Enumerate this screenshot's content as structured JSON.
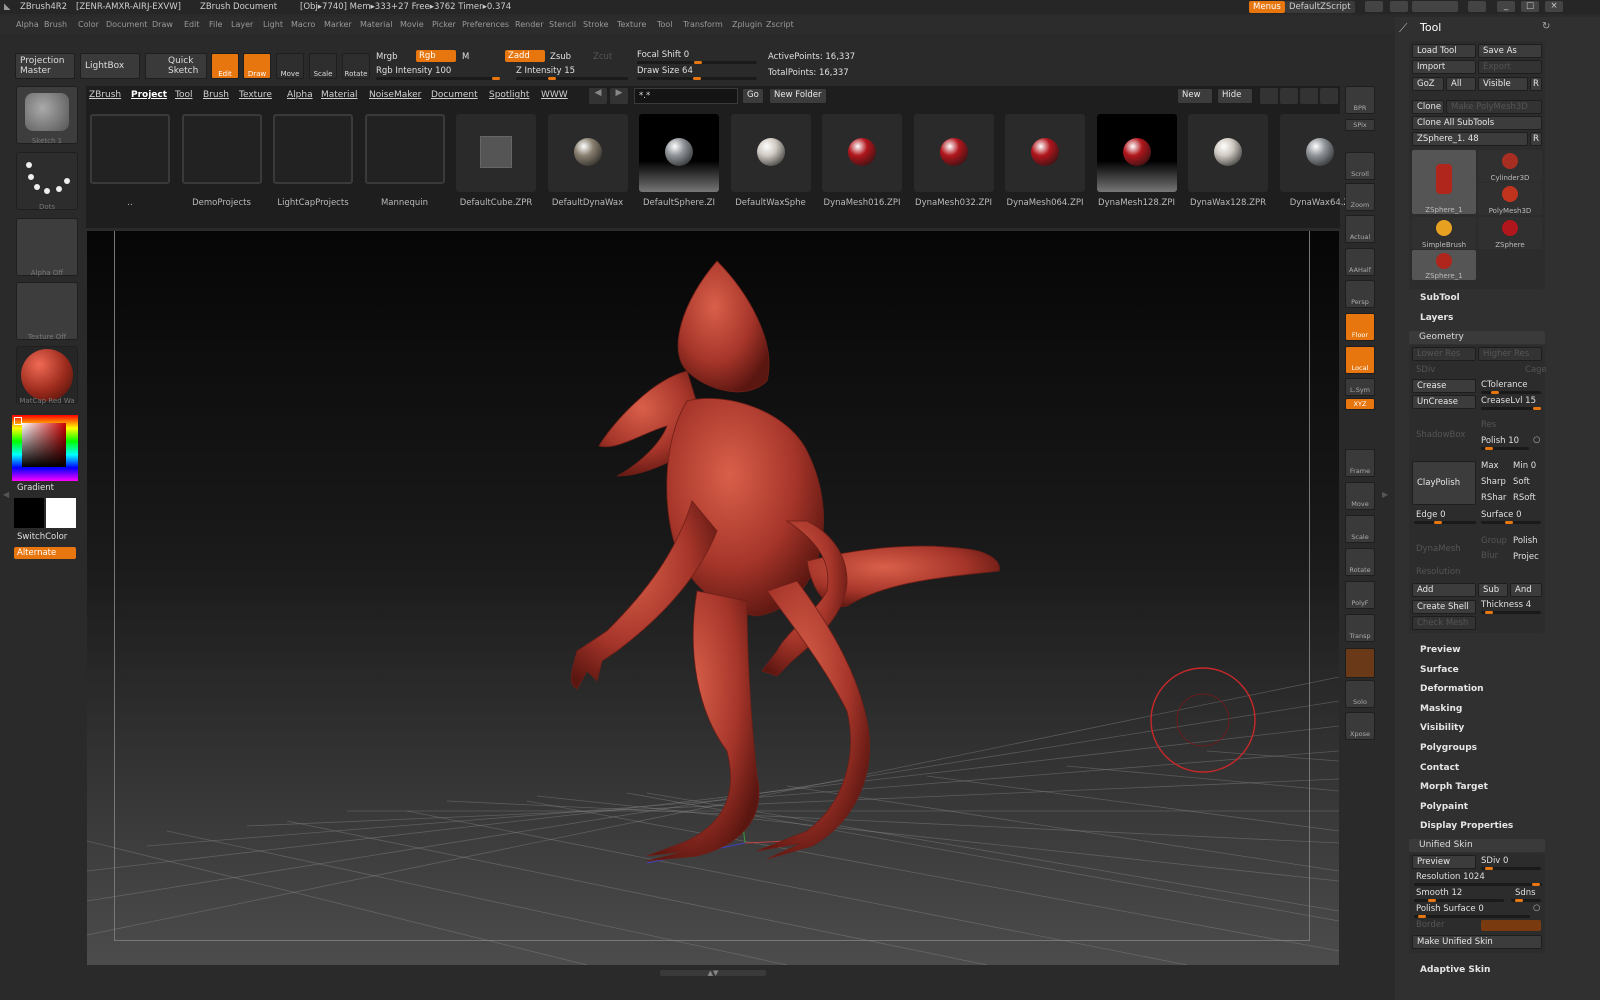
{
  "titlebar": {
    "app": "ZBrush4R2",
    "serial": "[ZENR-AMXR-AIRJ-EXVW]",
    "doc": "ZBrush Document",
    "stats": "[Obj▸7740] Mem▸333+27 Free▸3762 Timer▸0.374",
    "menus_btn": "Menus",
    "script_btn": "DefaultZScript"
  },
  "menubar": [
    "Alpha",
    "Brush",
    "Color",
    "Document",
    "Draw",
    "Edit",
    "File",
    "Layer",
    "Light",
    "Macro",
    "Marker",
    "Material",
    "Movie",
    "Picker",
    "Preferences",
    "Render",
    "Stencil",
    "Stroke",
    "Texture",
    "Tool",
    "Transform",
    "Zplugin",
    "Zscript"
  ],
  "toolbar": {
    "projection_master": "Projection Master",
    "lightbox": "LightBox",
    "quick_sketch": "Quick Sketch",
    "edit": "Edit",
    "draw": "Draw",
    "move": "Move",
    "scale": "Scale",
    "rotate": "Rotate",
    "mrgb": "Mrgb",
    "rgb": "Rgb",
    "m": "M",
    "zadd": "Zadd",
    "zsub": "Zsub",
    "zcut": "Zcut",
    "rgb_intensity": "Rgb Intensity 100",
    "z_intensity": "Z Intensity 15",
    "focal_shift": "Focal Shift 0",
    "draw_size": "Draw Size 64",
    "active_points": "ActivePoints: 16,337",
    "total_points": "TotalPoints: 16,337"
  },
  "leftshelf": {
    "sketch": "Sketch 1",
    "dots": "Dots",
    "alpha": "Alpha Off",
    "texture": "Texture Off",
    "matcap": "MatCap Red Wa",
    "gradient": "Gradient",
    "switchcolor": "SwitchColor",
    "alternate": "Alternate"
  },
  "lightbox": {
    "tabs": [
      "ZBrush",
      "Project",
      "Tool",
      "Brush",
      "Texture",
      "Alpha",
      "Material",
      "NoiseMaker",
      "Document",
      "Spotlight",
      "WWW"
    ],
    "search": "*.*",
    "go": "Go",
    "new_folder": "New Folder",
    "new": "New",
    "hide": "Hide",
    "items": [
      {
        "name": "..",
        "kind": "folder"
      },
      {
        "name": "DemoProjects",
        "kind": "folder"
      },
      {
        "name": "LightCapProjects",
        "kind": "folder"
      },
      {
        "name": "Mannequin",
        "kind": "folder"
      },
      {
        "name": "DefaultCube.ZPR",
        "kind": "cube"
      },
      {
        "name": "DefaultDynaWax",
        "kind": "ball",
        "color": "#8a8070"
      },
      {
        "name": "DefaultSphere.ZI",
        "kind": "ball",
        "color": "#8f9499"
      },
      {
        "name": "DefaultWaxSphe",
        "kind": "ball",
        "color": "#cfcac2"
      },
      {
        "name": "DynaMesh016.ZPI",
        "kind": "ball",
        "color": "#b0161c"
      },
      {
        "name": "DynaMesh032.ZPI",
        "kind": "ball",
        "color": "#b0161c"
      },
      {
        "name": "DynaMesh064.ZPI",
        "kind": "ball",
        "color": "#b0161c"
      },
      {
        "name": "DynaMesh128.ZPI",
        "kind": "ball",
        "color": "#b0161c"
      },
      {
        "name": "DynaWax128.ZPR",
        "kind": "ball",
        "color": "#cfcac2"
      },
      {
        "name": "DynaWax64.Z",
        "kind": "ball",
        "color": "#8f9499"
      }
    ]
  },
  "rightshelf": [
    "BPR",
    "SPix",
    "Scroll",
    "Zoom",
    "Actual",
    "AAHalf",
    "Persp",
    "Floor",
    "Local",
    "L.Sym",
    "XYZ",
    "",
    "",
    "Frame",
    "Move",
    "Scale",
    "Rotate",
    "PolyF",
    "Transp",
    "",
    "Solo",
    "Xpose"
  ],
  "tool": {
    "title": "Tool",
    "load_tool": "Load Tool",
    "save_as": "Save As",
    "import": "Import",
    "export": "Export",
    "goz": "GoZ",
    "all": "All",
    "visible": "Visible",
    "r": "R",
    "clone": "Clone",
    "make_polymesh": "Make PolyMesh3D",
    "clone_all": "Clone All SubTools",
    "current": "ZSphere_1. 48",
    "thumbs": [
      {
        "name": "ZSphere_1"
      },
      {
        "name": "Cylinder3D"
      },
      {
        "name": "PolyMesh3D"
      },
      {
        "name": "SimpleBrush"
      },
      {
        "name": "ZSphere"
      },
      {
        "name": "ZSphere_1"
      }
    ],
    "subtool": "SubTool",
    "layers": "Layers",
    "geometry": "Geometry",
    "lower_res": "Lower Res",
    "higher_res": "Higher Res",
    "sdiv": "SDiv",
    "cage": "Cage",
    "crease": "Crease",
    "ctolerance": "CTolerance",
    "uncrease": "UnCrease",
    "creaselvl": "CreaseLvl 15",
    "res": "Res",
    "shadowbox": "ShadowBox",
    "polish10": "Polish 10",
    "claypolish": "ClayPolish",
    "max": "Max",
    "min": "Min 0",
    "sharp": "Sharp",
    "soft": "Soft",
    "rshar": "RShar",
    "rsoft": "RSoft",
    "edge": "Edge 0",
    "surface0": "Surface 0",
    "group": "Group",
    "polish": "Polish",
    "dynamesh": "DynaMesh",
    "blur": "Blur",
    "projec": "Projec",
    "resolution": "Resolution",
    "add": "Add",
    "sub": "Sub",
    "and": "And",
    "create_shell": "Create Shell",
    "thickness": "Thickness 4",
    "check_mesh": "Check Mesh",
    "sections": [
      "Preview",
      "Surface",
      "Deformation",
      "Masking",
      "Visibility",
      "Polygroups",
      "Contact",
      "Morph Target",
      "Polypaint",
      "Display Properties"
    ],
    "unified_skin": "Unified Skin",
    "us_preview": "Preview",
    "us_sdiv": "SDiv 0",
    "us_resolution": "Resolution 1024",
    "us_smooth": "Smooth 12",
    "us_sdns": "Sdns",
    "us_polish_surface": "Polish Surface 0",
    "us_border": "Border",
    "us_make": "Make Unified Skin",
    "adaptive_skin": "Adaptive Skin"
  }
}
